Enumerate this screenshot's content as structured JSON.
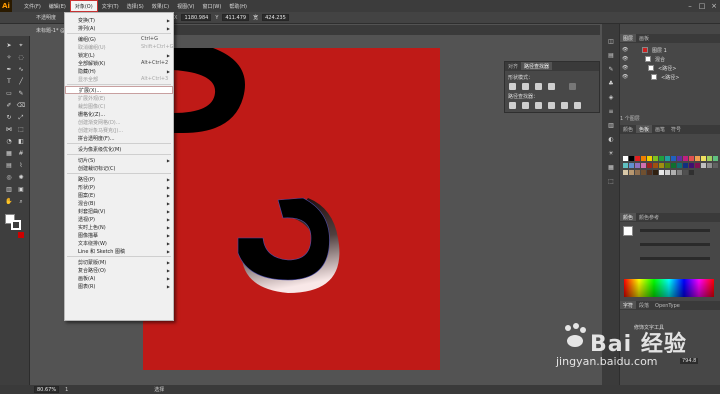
{
  "app": {
    "logo": "Ai"
  },
  "menubar": {
    "items": [
      "文件(F)",
      "编辑(E)",
      "对象(O)",
      "文字(T)",
      "选择(S)",
      "效果(C)",
      "视图(V)",
      "窗口(W)",
      "帮助(H)"
    ],
    "active_index": 2
  },
  "controlbar": {
    "mode_label": "不透明度",
    "x_value": "1180.984",
    "y_value": "411.479",
    "w_value": "424.235",
    "h_value": "",
    "x_label": "X",
    "y_label": "Y",
    "w_label": "宽"
  },
  "document": {
    "tab_label": "未标题-1* @ 80% (RGB/GPU 预览)"
  },
  "dropdown": {
    "items": [
      {
        "label": "变换(T)",
        "shortcut": "",
        "arrow": true,
        "disabled": false
      },
      {
        "label": "排列(A)",
        "shortcut": "",
        "arrow": true,
        "disabled": false
      },
      {
        "sep": true
      },
      {
        "label": "编组(G)",
        "shortcut": "Ctrl+G",
        "arrow": false,
        "disabled": false
      },
      {
        "label": "取消编组(U)",
        "shortcut": "Shift+Ctrl+G",
        "arrow": false,
        "disabled": true
      },
      {
        "label": "锁定(L)",
        "shortcut": "",
        "arrow": true,
        "disabled": false
      },
      {
        "label": "全部解锁(K)",
        "shortcut": "Alt+Ctrl+2",
        "arrow": false,
        "disabled": false
      },
      {
        "label": "隐藏(H)",
        "shortcut": "",
        "arrow": true,
        "disabled": false
      },
      {
        "label": "显示全部",
        "shortcut": "Alt+Ctrl+3",
        "arrow": false,
        "disabled": true
      },
      {
        "sep": true
      },
      {
        "label": "扩展(X)...",
        "shortcut": "",
        "arrow": false,
        "disabled": false,
        "highlight": true
      },
      {
        "label": "扩展外观(E)",
        "shortcut": "",
        "arrow": false,
        "disabled": true
      },
      {
        "label": "裁剪图像(C)",
        "shortcut": "",
        "arrow": false,
        "disabled": true
      },
      {
        "label": "栅格化(Z)...",
        "shortcut": "",
        "arrow": false,
        "disabled": false
      },
      {
        "label": "创建渐变网格(D)...",
        "shortcut": "",
        "arrow": false,
        "disabled": true
      },
      {
        "label": "创建对象马赛克(J)...",
        "shortcut": "",
        "arrow": false,
        "disabled": true
      },
      {
        "label": "拼合透明度(F)...",
        "shortcut": "",
        "arrow": false,
        "disabled": false
      },
      {
        "sep": true
      },
      {
        "label": "设为像素级优化(M)",
        "shortcut": "",
        "arrow": false,
        "disabled": false
      },
      {
        "sep": true
      },
      {
        "label": "切片(S)",
        "shortcut": "",
        "arrow": true,
        "disabled": false
      },
      {
        "label": "创建裁切标记(C)",
        "shortcut": "",
        "arrow": false,
        "disabled": false
      },
      {
        "sep": true
      },
      {
        "label": "路径(P)",
        "shortcut": "",
        "arrow": true,
        "disabled": false
      },
      {
        "label": "形状(P)",
        "shortcut": "",
        "arrow": true,
        "disabled": false
      },
      {
        "label": "图案(E)",
        "shortcut": "",
        "arrow": true,
        "disabled": false
      },
      {
        "label": "混合(B)",
        "shortcut": "",
        "arrow": true,
        "disabled": false
      },
      {
        "label": "封套扭曲(V)",
        "shortcut": "",
        "arrow": true,
        "disabled": false
      },
      {
        "label": "透视(P)",
        "shortcut": "",
        "arrow": true,
        "disabled": false
      },
      {
        "label": "实时上色(N)",
        "shortcut": "",
        "arrow": true,
        "disabled": false
      },
      {
        "label": "图像描摹",
        "shortcut": "",
        "arrow": true,
        "disabled": false
      },
      {
        "label": "文本绕排(W)",
        "shortcut": "",
        "arrow": true,
        "disabled": false
      },
      {
        "label": "Line 和 Sketch 图稿",
        "shortcut": "",
        "arrow": true,
        "disabled": false
      },
      {
        "sep": true
      },
      {
        "label": "剪切蒙版(M)",
        "shortcut": "",
        "arrow": true,
        "disabled": false
      },
      {
        "label": "复合路径(O)",
        "shortcut": "",
        "arrow": true,
        "disabled": false
      },
      {
        "label": "画板(A)",
        "shortcut": "",
        "arrow": true,
        "disabled": false
      },
      {
        "label": "图表(R)",
        "shortcut": "",
        "arrow": true,
        "disabled": false
      }
    ]
  },
  "layers_panel": {
    "tabs": [
      "图层",
      "画板"
    ],
    "rows": [
      {
        "name": "图层 1"
      },
      {
        "name": "混合"
      },
      {
        "name": "<路径>"
      },
      {
        "name": "<路径>"
      }
    ],
    "footer": "1 个图层"
  },
  "pathfinder_panel": {
    "tabs": [
      "对齐",
      "路径查找器"
    ],
    "shape_modes_label": "形状模式：",
    "pathfinders_label": "路径查找器："
  },
  "swatches_panel": {
    "tabs": [
      "颜色",
      "色板",
      "画笔",
      "符号"
    ]
  },
  "color_panel": {
    "tabs": [
      "颜色",
      "颜色参考"
    ]
  },
  "char_panel": {
    "tabs": [
      "字符",
      "段落",
      "OpenType"
    ],
    "label": "修饰文字工具",
    "size_value": "794.8"
  },
  "statusbar": {
    "zoom": "80.67%",
    "page": "1",
    "tool": "选择"
  },
  "watermark": {
    "brand": "Bai 经验",
    "url": "jingyan.baidu.com"
  },
  "colors": {
    "artboard": "#bf1a17",
    "menu_bg": "#f0f0f0",
    "ui_dark": "#3c3c3c",
    "accent": "#ff9a00"
  }
}
